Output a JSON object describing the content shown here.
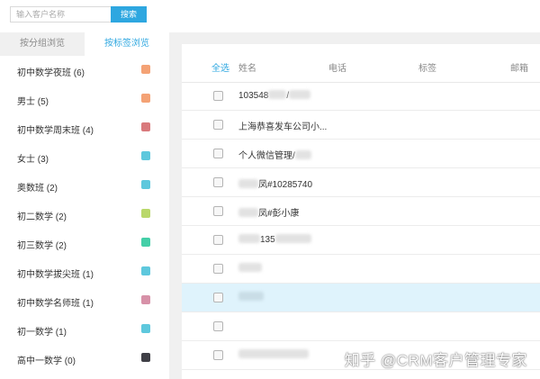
{
  "search": {
    "placeholder": "输入客户名称",
    "button_label": "搜索"
  },
  "sidebar": {
    "tabs": [
      {
        "label": "按分组浏览",
        "active": false
      },
      {
        "label": "按标签浏览",
        "active": true
      }
    ],
    "tags": [
      {
        "label": "初中数学夜班 (6)",
        "color": "#f4a275"
      },
      {
        "label": "男士 (5)",
        "color": "#f4a275"
      },
      {
        "label": "初中数学周末班 (4)",
        "color": "#d9797c"
      },
      {
        "label": "女士 (3)",
        "color": "#5ec8dd"
      },
      {
        "label": "奥数班 (2)",
        "color": "#5ec8dd"
      },
      {
        "label": "初二数学 (2)",
        "color": "#b9d86a"
      },
      {
        "label": "初三数学 (2)",
        "color": "#44cfa8"
      },
      {
        "label": "初中数学拔尖班 (1)",
        "color": "#5ec8dd"
      },
      {
        "label": "初中数学名师班 (1)",
        "color": "#d791a8"
      },
      {
        "label": "初一数学 (1)",
        "color": "#5ec8dd"
      },
      {
        "label": "高中一数学 (0)",
        "color": "#3f3f46"
      }
    ]
  },
  "table": {
    "headers": {
      "select_all": "全选",
      "name": "姓名",
      "phone": "电话",
      "tags": "标签",
      "email": "邮箱"
    },
    "rows": [
      {
        "name_a": "103548",
        "name_b": "/",
        "highlight": false
      },
      {
        "name_a": "上海恭喜发车公司小...",
        "name_b": "",
        "highlight": false
      },
      {
        "name_a": "个人微信管理/",
        "name_b": "",
        "highlight": false
      },
      {
        "name_a": "",
        "name_b": "凤#10285740",
        "highlight": false
      },
      {
        "name_a": "",
        "name_b": "凤#彭小康",
        "highlight": false
      },
      {
        "name_a": "",
        "name_b": "135",
        "highlight": false
      },
      {
        "name_a": "",
        "name_b": "",
        "highlight": false
      },
      {
        "name_a": "",
        "name_b": "",
        "highlight": true
      },
      {
        "name_a": "",
        "name_b": "",
        "highlight": false
      },
      {
        "name_a": "",
        "name_b": "",
        "highlight": false
      }
    ]
  },
  "watermark": "知乎 @CRM客户管理专家"
}
